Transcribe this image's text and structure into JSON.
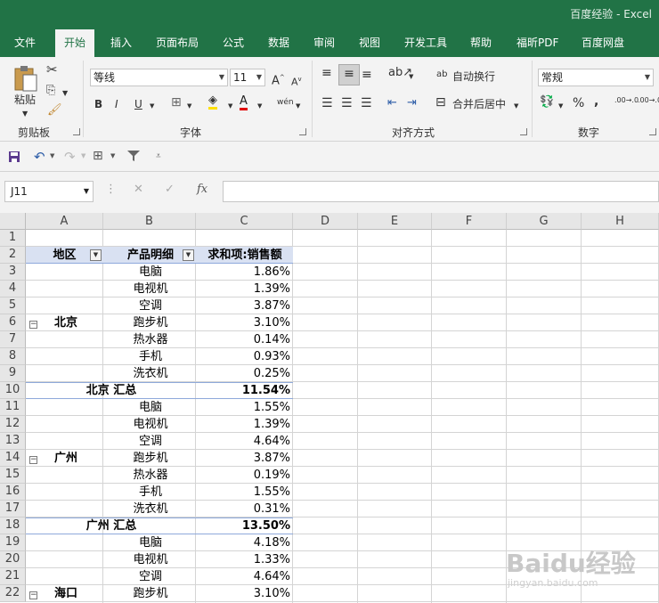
{
  "window": {
    "title": "百度经验  -  Excel"
  },
  "menu": {
    "items": [
      "文件",
      "开始",
      "插入",
      "页面布局",
      "公式",
      "数据",
      "审阅",
      "视图",
      "开发工具",
      "帮助",
      "福昕PDF",
      "百度网盘"
    ],
    "active": "开始"
  },
  "ribbon": {
    "clipboard": {
      "label": "剪贴板",
      "paste": "粘贴"
    },
    "font": {
      "label": "字体",
      "name": "等线",
      "size": "11",
      "bold": "B",
      "italic": "I",
      "underline": "U",
      "grow": "A",
      "shrink": "A",
      "color_letter": "A",
      "phonetic": "wén"
    },
    "alignment": {
      "label": "对齐方式",
      "wrap": "自动换行",
      "merge": "合并后居中"
    },
    "number": {
      "label": "数字",
      "format": "常规",
      "percent": "%",
      "comma": ",",
      "inc_dec": ".00→.0",
      "dec_dec": ".00→.0"
    }
  },
  "formula_bar": {
    "name_box": "J11",
    "fx": "fx",
    "value": ""
  },
  "sheet": {
    "columns": [
      "A",
      "B",
      "C",
      "D",
      "E",
      "F",
      "G",
      "H"
    ],
    "rows": [
      "1",
      "2",
      "3",
      "4",
      "5",
      "6",
      "7",
      "8",
      "9",
      "10",
      "11",
      "12",
      "13",
      "14",
      "15",
      "16",
      "17",
      "18",
      "19",
      "20",
      "21",
      "22"
    ],
    "pivot": {
      "headers": {
        "region": "地区",
        "product": "产品明细",
        "sum": "求和项:销售额"
      },
      "groups": [
        {
          "region": "北京",
          "items": [
            {
              "product": "电脑",
              "value": "1.86%"
            },
            {
              "product": "电视机",
              "value": "1.39%"
            },
            {
              "product": "空调",
              "value": "3.87%"
            },
            {
              "product": "跑步机",
              "value": "3.10%"
            },
            {
              "product": "热水器",
              "value": "0.14%"
            },
            {
              "product": "手机",
              "value": "0.93%"
            },
            {
              "product": "洗衣机",
              "value": "0.25%"
            }
          ],
          "total_label": "北京 汇总",
          "total": "11.54%"
        },
        {
          "region": "广州",
          "items": [
            {
              "product": "电脑",
              "value": "1.55%"
            },
            {
              "product": "电视机",
              "value": "1.39%"
            },
            {
              "product": "空调",
              "value": "4.64%"
            },
            {
              "product": "跑步机",
              "value": "3.87%"
            },
            {
              "product": "热水器",
              "value": "0.19%"
            },
            {
              "product": "手机",
              "value": "1.55%"
            },
            {
              "product": "洗衣机",
              "value": "0.31%"
            }
          ],
          "total_label": "广州 汇总",
          "total": "13.50%"
        },
        {
          "region": "海口",
          "items": [
            {
              "product": "电脑",
              "value": "4.18%"
            },
            {
              "product": "电视机",
              "value": "1.33%"
            },
            {
              "product": "空调",
              "value": "4.64%"
            },
            {
              "product": "跑步机",
              "value": "3.10%"
            }
          ]
        }
      ]
    }
  },
  "watermark": {
    "text": "Baidu经验",
    "url": "jingyan.baidu.com"
  }
}
